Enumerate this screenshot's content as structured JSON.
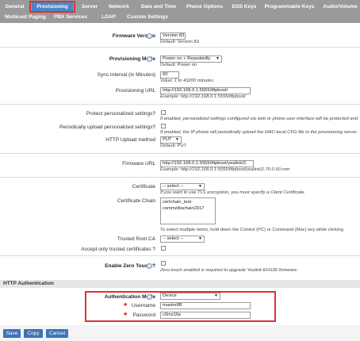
{
  "tabs": [
    {
      "label": "General"
    },
    {
      "label": "Provisioning"
    },
    {
      "label": "Server"
    },
    {
      "label": "Network"
    },
    {
      "label": "Date and Time"
    },
    {
      "label": "Phone Options"
    },
    {
      "label": "DSS Keys"
    },
    {
      "label": "Programmable Keys"
    },
    {
      "label": "Audio/Volume"
    },
    {
      "label": "Multicast Paging"
    },
    {
      "label": "PBX Services"
    },
    {
      "label": "LDAP"
    },
    {
      "label": "Custom Settings"
    }
  ],
  "firmware": {
    "label": "Firmware Version",
    "value": "Version 83",
    "default": "Default: Version 83"
  },
  "mode": {
    "label": "Provisioning Mode",
    "value": "Power on + Repeatedly",
    "default": "Default: Power on"
  },
  "sync": {
    "label": "Sync Interval (in Minutes)",
    "value": "60",
    "hint": "Value: 1 to 43200 minutes"
  },
  "prov_url": {
    "label": "Provisioning URL",
    "value": "http://192.168.0.1:5555/tftpboot/",
    "hint": "Example: http://192.168.0.1:5555/tftpboot/"
  },
  "protect": {
    "label": "Protect personalized settings?",
    "hint": "If enabled, personalized settings configured via web or phone user interface will be protected and"
  },
  "periodic": {
    "label": "Periodically upload personalized settings?",
    "hint": "If enabled, the IP phone will periodically upload the MAC-local.CFG file to the provisioning server."
  },
  "upload": {
    "label": "HTTP Upload method",
    "value": "PUT",
    "default": "Default: PUT"
  },
  "fw_url": {
    "label": "Firmware URL",
    "value": "http://192.168.0.1:5555/tftpboot/yealink/2.",
    "hint": "Example: http://192.168.0.1:5555/tftpboot/yealink/2.70.0.50.rom"
  },
  "cert": {
    "label": "Certificate",
    "value": "-- select --",
    "hint": "If you want to use TLS encryption, you must specify a Client Certificate."
  },
  "chain": {
    "label": "Certificate Chain",
    "items": [
      "certchain_test",
      "commzillachain2017"
    ],
    "hint": "To select multiple items, hold down the Control (PC) or Command (Mac) key while clicking."
  },
  "trusted": {
    "label": "Trusted Root CA",
    "value": "-- select --"
  },
  "accept": {
    "label": "Accept only trusted certificates ?"
  },
  "zero": {
    "label": "Enable Zero Touch ?",
    "hint": "Zero touch enabled is required to upgrade Yealink EHS36 firmware."
  },
  "http_auth": {
    "title": "HTTP Authentication"
  },
  "auth_mode": {
    "label": "Authentication Mode",
    "value": "Device"
  },
  "username": {
    "label": "Username",
    "value": "master88"
  },
  "password": {
    "label": "Password",
    "value": "c0mz1lla"
  },
  "buttons": {
    "save": "Save",
    "copy": "Copy",
    "cancel": "Cancel"
  },
  "colon": ":",
  "star": "★",
  "arrow": "▼"
}
